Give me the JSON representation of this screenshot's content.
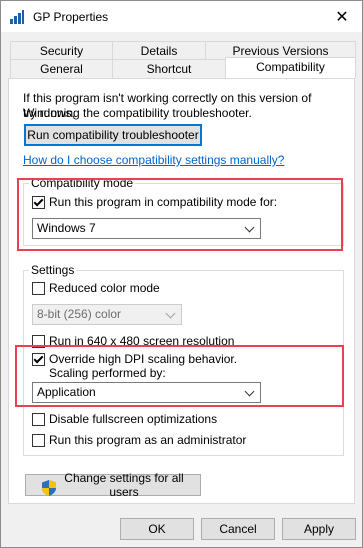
{
  "window": {
    "title": "GP Properties",
    "close_glyph": "✕"
  },
  "tabs": {
    "row1": [
      "Security",
      "Details",
      "Previous Versions"
    ],
    "row2": [
      "General",
      "Shortcut",
      "Compatibility"
    ]
  },
  "intro": {
    "line1": "If this program isn't working correctly on this version of Windows,",
    "line2": "try running the compatibility troubleshooter.",
    "troubleshooter_button": "Run compatibility troubleshooter",
    "manual_link": "How do I choose compatibility settings manually?"
  },
  "compat_mode": {
    "legend": "Compatibility mode",
    "checkbox_label": "Run this program in compatibility mode for:",
    "checked": true,
    "selected_os": "Windows 7"
  },
  "settings": {
    "legend": "Settings",
    "reduced_color": {
      "label": "Reduced color mode",
      "checked": false
    },
    "color_select": "8-bit (256) color",
    "resolution_640": {
      "label": "Run in 640 x 480 screen resolution",
      "checked": false
    },
    "dpi_override": {
      "label_line1": "Override high DPI scaling behavior.",
      "label_line2": "Scaling performed by:",
      "checked": true
    },
    "dpi_select": "Application",
    "disable_fullscreen": {
      "label": "Disable fullscreen optimizations",
      "checked": false
    },
    "run_as_admin": {
      "label": "Run this program as an administrator",
      "checked": false
    }
  },
  "change_settings_button": "Change settings for all users",
  "footer": {
    "ok": "OK",
    "cancel": "Cancel",
    "apply": "Apply"
  },
  "colors": {
    "highlight": "#e8414f",
    "link": "#0066cc",
    "focus": "#0078d7"
  },
  "icons": [
    "app-icon",
    "close-icon",
    "checkmark-icon",
    "chevron-down-icon",
    "shield-icon"
  ]
}
